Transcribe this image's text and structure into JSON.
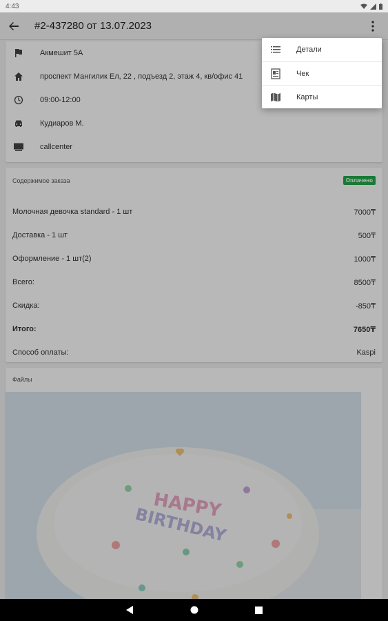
{
  "status_bar": {
    "time": "4:43"
  },
  "app_bar": {
    "title": "#2-437280 от 13.07.2023"
  },
  "info": [
    {
      "icon": "flag-icon",
      "text": "Акмешит 5А"
    },
    {
      "icon": "home-icon",
      "text": "проспект Мангилик Ел, 22 , подъезд 2, этаж 4, кв/офис 41"
    },
    {
      "icon": "clock-icon",
      "text": "09:00-12:00"
    },
    {
      "icon": "car-icon",
      "text": "Кудиаров М."
    },
    {
      "icon": "computer-icon",
      "text": "callcenter"
    }
  ],
  "order": {
    "title": "Содержимое заказа",
    "badge": "Оплачено",
    "badge_color": "#22a94a",
    "rows": [
      {
        "label": "Молочная девочка standard - 1 шт",
        "value": "7000₸"
      },
      {
        "label": "Доставка - 1 шт",
        "value": "500₸"
      },
      {
        "label": "Оформление - 1 шт(2)",
        "value": "1000₸"
      },
      {
        "label": "Всего:",
        "value": "8500₸"
      },
      {
        "label": "Скидка:",
        "value": "-850₸"
      },
      {
        "label": "Итого:",
        "value": "7650₸"
      },
      {
        "label": "Способ оплаты:",
        "value": "Kaspi"
      }
    ]
  },
  "files": {
    "title": "Файлы",
    "photo_text_1": "HAPPY",
    "photo_text_2": "BIRTHDAY"
  },
  "menu": [
    {
      "icon": "list-icon",
      "label": "Детали"
    },
    {
      "icon": "receipt-icon",
      "label": "Чек"
    },
    {
      "icon": "map-icon",
      "label": "Карты"
    }
  ]
}
